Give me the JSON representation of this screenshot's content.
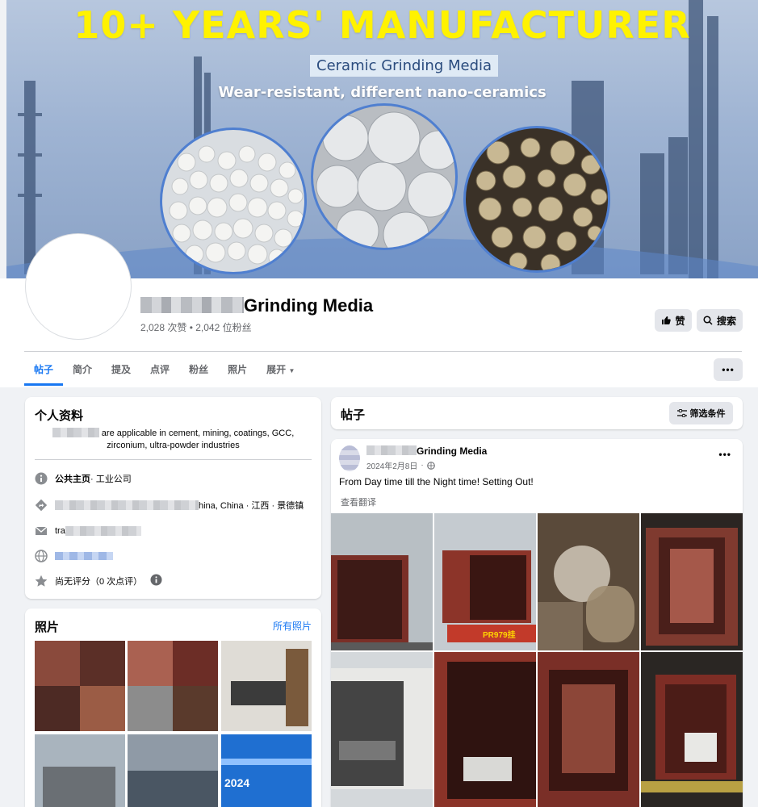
{
  "cover": {
    "headline": "10+ YEARS' MANUFACTURER",
    "product": "Ceramic Grinding Media",
    "tagline": "Wear-resistant, different nano-ceramics"
  },
  "page": {
    "name_suffix": "Grinding Media",
    "stats": "2,028 次赞 • 2,042 位粉丝",
    "like_label": "赞",
    "search_label": "搜索"
  },
  "tabs": [
    "帖子",
    "简介",
    "提及",
    "点评",
    "粉丝",
    "照片",
    "展开"
  ],
  "intro": {
    "title": "个人资料",
    "bio_line1": "are applicable in cement, mining, coatings, GCC,",
    "bio_line2": "zirconium, ultra-powder industries",
    "category_label": "公共主页",
    "category_value": " · 工业公司",
    "address_tail": "hina, China · 江西 · 景德镇",
    "email_prefix": "tra",
    "rating": "尚无评分（0 次点评）"
  },
  "photos": {
    "title": "照片",
    "all_link": "所有照片"
  },
  "posts_bar": {
    "title": "帖子",
    "filter_label": "筛选条件"
  },
  "post": {
    "author_suffix": "Grinding Media",
    "date": "2024年2月8日",
    "text": "From Day time till the Night time! Setting Out!",
    "translate": "查看翻译",
    "truck_plate": "PR979挂"
  },
  "photo_banner_text": "2024",
  "colors": {
    "accent": "#1877f2",
    "cover_headline": "#fff200",
    "container_red": "#7a2f27"
  }
}
